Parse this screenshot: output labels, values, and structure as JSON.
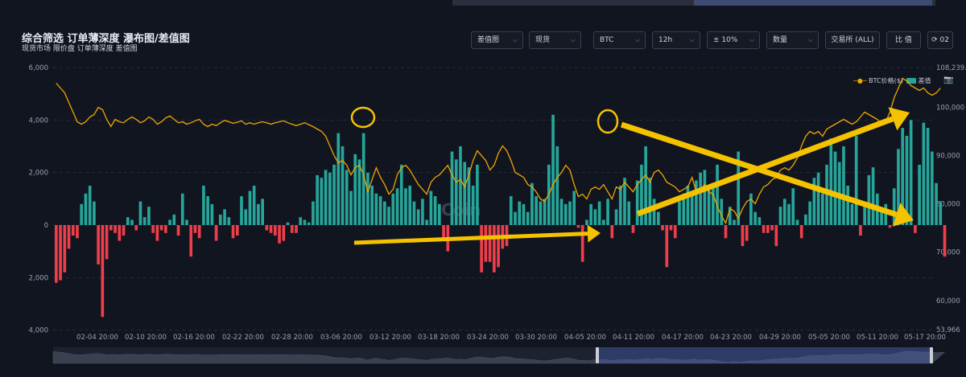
{
  "header": {
    "title": "综合筛选 订单薄深度 瀑布图/差值图",
    "subtitle": "现货市场 限价盘 订单薄深度 差值图"
  },
  "controls": {
    "chart_type": "差值图",
    "market": "现货",
    "coin": "BTC",
    "interval": "12h",
    "range": "± 10%",
    "metric": "数量",
    "exchange": "交易所 (ALL)",
    "compare": "比 值",
    "refresh_count": "02"
  },
  "legend": {
    "price": "BTC价格($)",
    "diff": "差值"
  },
  "watermark": "Coin",
  "colors": {
    "bg": "#111520",
    "price": "#f0a500",
    "pos": "#26a69a",
    "neg": "#ef3e4a",
    "annot": "#f5c200"
  },
  "chart_data": {
    "type": "bar",
    "left_axis": {
      "ticks": [
        "6,000",
        "4,000",
        "2,000",
        "0",
        "2,000",
        "4,000"
      ],
      "ylim": [
        -4000,
        6000
      ]
    },
    "right_axis": {
      "ticks": [
        "108,239.2",
        "100,000",
        "90,000",
        "80,000",
        "70,000",
        "60,000",
        "53,966"
      ],
      "ylim": [
        53966,
        108239.2
      ]
    },
    "xticks": [
      "02-04 20:00",
      "02-10 20:00",
      "02-16 20:00",
      "02-22 20:00",
      "02-28 20:00",
      "03-06 20:00",
      "03-12 20:00",
      "03-18 20:00",
      "03-24 20:00",
      "03-30 20:00",
      "04-05 20:00",
      "04-11 20:00",
      "04-17 20:00",
      "04-23 20:00",
      "04-29 20:00",
      "05-05 20:00",
      "05-11 20:00",
      "05-17 20:00"
    ],
    "n": 208,
    "diff": [
      -2200,
      -2100,
      -1800,
      -900,
      -400,
      -500,
      800,
      1200,
      1500,
      900,
      -1500,
      -3500,
      -1300,
      -200,
      -300,
      -600,
      -400,
      300,
      200,
      -200,
      900,
      300,
      700,
      -300,
      -600,
      -200,
      -300,
      200,
      400,
      -400,
      1200,
      200,
      -1200,
      -300,
      -500,
      1500,
      1100,
      800,
      -600,
      400,
      600,
      300,
      -500,
      -400,
      1100,
      600,
      1300,
      1500,
      800,
      1000,
      -200,
      -300,
      -400,
      -700,
      -600,
      100,
      -300,
      -300,
      300,
      200,
      100,
      900,
      1900,
      1800,
      2100,
      2000,
      2300,
      3500,
      3000,
      2100,
      1300,
      2700,
      2500,
      3500,
      2000,
      1500,
      1200,
      1100,
      900,
      700,
      1200,
      1400,
      2300,
      1400,
      1500,
      900,
      600,
      1000,
      200,
      1300,
      1100,
      800,
      -600,
      -1000,
      2800,
      2500,
      3000,
      2400,
      2200,
      1500,
      2300,
      -1800,
      -1400,
      -1400,
      -1800,
      -1600,
      -900,
      -800,
      1100,
      500,
      900,
      800,
      500,
      1600,
      1100,
      900,
      1000,
      2300,
      4200,
      3000,
      1000,
      800,
      900,
      1300,
      -100,
      -1400,
      200,
      800,
      600,
      900,
      200,
      1000,
      -500,
      600,
      1500,
      1800,
      900,
      -300,
      1700,
      2300,
      3000,
      1800,
      1000,
      500,
      -200,
      -1600,
      -200,
      -500,
      900,
      1200,
      1500,
      1300,
      1700,
      2000,
      2100,
      1400,
      1600,
      2300,
      1000,
      -500,
      700,
      200,
      2800,
      -800,
      -600,
      1200,
      500,
      300,
      -300,
      -300,
      -200,
      -800,
      700,
      1000,
      800,
      1400,
      200,
      -500,
      400,
      900,
      1800,
      2000,
      1200,
      2300,
      3300,
      2800,
      2400,
      3000,
      1500,
      800,
      3400,
      -400,
      700,
      1900,
      2200,
      1200,
      600,
      800,
      -100,
      1400,
      2900,
      3700,
      3400,
      4000,
      -300,
      2300,
      3900,
      3700,
      2800,
      1600,
      900,
      -1200
    ],
    "price": [
      105000,
      104000,
      103000,
      101000,
      99000,
      97000,
      96500,
      97000,
      98000,
      98500,
      100000,
      99500,
      97500,
      96000,
      97500,
      97000,
      96800,
      97500,
      98000,
      97500,
      96800,
      97200,
      98000,
      97500,
      96500,
      97000,
      97800,
      98200,
      97500,
      96800,
      97000,
      96500,
      96800,
      97200,
      97500,
      96500,
      96000,
      96500,
      96200,
      96800,
      97300,
      97000,
      96700,
      96900,
      97200,
      96500,
      96800,
      96500,
      96800,
      97000,
      96800,
      96500,
      96800,
      97000,
      97200,
      96800,
      96500,
      96200,
      96500,
      96800,
      96400,
      96000,
      95500,
      95000,
      94000,
      92000,
      90000,
      88500,
      89000,
      88000,
      86000,
      87500,
      88000,
      86000,
      82500,
      85000,
      87500,
      85500,
      84000,
      82000,
      83000,
      86000,
      87500,
      88000,
      87000,
      85500,
      84000,
      83000,
      82000,
      84500,
      85500,
      86000,
      87000,
      88000,
      86000,
      84500,
      85000,
      83500,
      86000,
      89000,
      91000,
      90000,
      89000,
      87000,
      88000,
      90500,
      92000,
      91000,
      89000,
      86500,
      86000,
      85500,
      84000,
      83500,
      82500,
      81000,
      80500,
      82000,
      84000,
      85500,
      86500,
      88000,
      87000,
      84000,
      81500,
      82000,
      81000,
      83000,
      83500,
      83000,
      84000,
      82500,
      81000,
      83500,
      83000,
      84500,
      83500,
      82500,
      84000,
      85000,
      86000,
      84500,
      86500,
      87000,
      86000,
      84500,
      84000,
      83500,
      82500,
      83000,
      83500,
      85500,
      82500,
      83000,
      84000,
      82500,
      82000,
      79500,
      77500,
      76000,
      79000,
      78500,
      77000,
      79000,
      80500,
      81000,
      80000,
      82000,
      83500,
      84000,
      85000,
      85500,
      87000,
      87500,
      87000,
      88000,
      89500,
      92000,
      94000,
      95000,
      94500,
      95000,
      94000,
      95500,
      96000,
      96500,
      97000,
      97500,
      97000,
      96500,
      97000,
      98000,
      99000,
      98500,
      98000,
      97500,
      96500,
      97000,
      99000,
      102000,
      104000,
      106000,
      105500,
      104500,
      104000,
      103500,
      104000,
      103000,
      102500,
      103000,
      104000
    ]
  }
}
